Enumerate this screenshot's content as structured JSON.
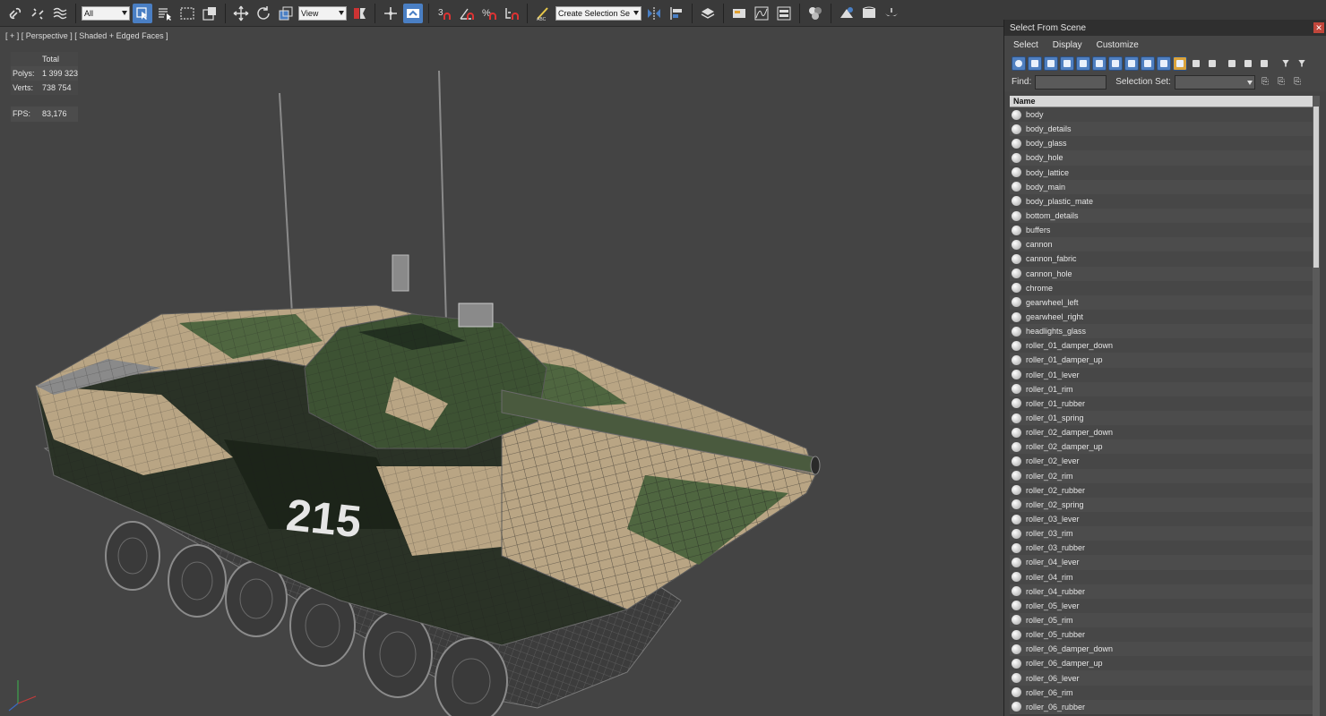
{
  "toolbar": {
    "filter_value": "All",
    "coord_value": "View",
    "named_selection_value": "Create Selection Se",
    "icons": [
      "link-icon",
      "unlink-icon",
      "bind-icon",
      "select-object-icon",
      "select-by-name-icon",
      "rect-region-icon",
      "window-crossing-icon",
      "move-icon",
      "rotate-icon",
      "scale-icon",
      "mirror-icon",
      "snaps-icon",
      "angle-snap-icon",
      "percent-snap-icon",
      "spinner-snap-icon",
      "edit-named-sel-icon",
      "align-icon",
      "layer-icon",
      "render-setup-icon",
      "render-icon"
    ]
  },
  "viewport": {
    "label": "[ + ] [ Perspective ] [ Shaded + Edged Faces ]",
    "stats": {
      "total_label": "Total",
      "polys_label": "Polys:",
      "polys_value": "1 399 323",
      "verts_label": "Verts:",
      "verts_value": "738 754",
      "fps_label": "FPS:",
      "fps_value": "83,176"
    },
    "tank_number": "215"
  },
  "panel": {
    "title": "Select From Scene",
    "menu": [
      "Select",
      "Display",
      "Customize"
    ],
    "find_label": "Find:",
    "selection_set_label": "Selection Set:",
    "column_header": "Name",
    "items": [
      "body",
      "body_details",
      "body_glass",
      "body_hole",
      "body_lattice",
      "body_main",
      "body_plastic_mate",
      "bottom_details",
      "buffers",
      "cannon",
      "cannon_fabric",
      "cannon_hole",
      "chrome",
      "gearwheel_left",
      "gearwheel_right",
      "headlights_glass",
      "roller_01_damper_down",
      "roller_01_damper_up",
      "roller_01_lever",
      "roller_01_rim",
      "roller_01_rubber",
      "roller_01_spring",
      "roller_02_damper_down",
      "roller_02_damper_up",
      "roller_02_lever",
      "roller_02_rim",
      "roller_02_rubber",
      "roller_02_spring",
      "roller_03_lever",
      "roller_03_rim",
      "roller_03_rubber",
      "roller_04_lever",
      "roller_04_rim",
      "roller_04_rubber",
      "roller_05_lever",
      "roller_05_rim",
      "roller_05_rubber",
      "roller_06_damper_down",
      "roller_06_damper_up",
      "roller_06_lever",
      "roller_06_rim",
      "roller_06_rubber"
    ]
  },
  "colors": {
    "viewport_bg": "#444444",
    "stats_text": "#e8d64a",
    "accent": "#4a7fc4",
    "camo_sand": "#b9a584",
    "camo_green": "#4f6640",
    "camo_dark": "#232d22"
  }
}
